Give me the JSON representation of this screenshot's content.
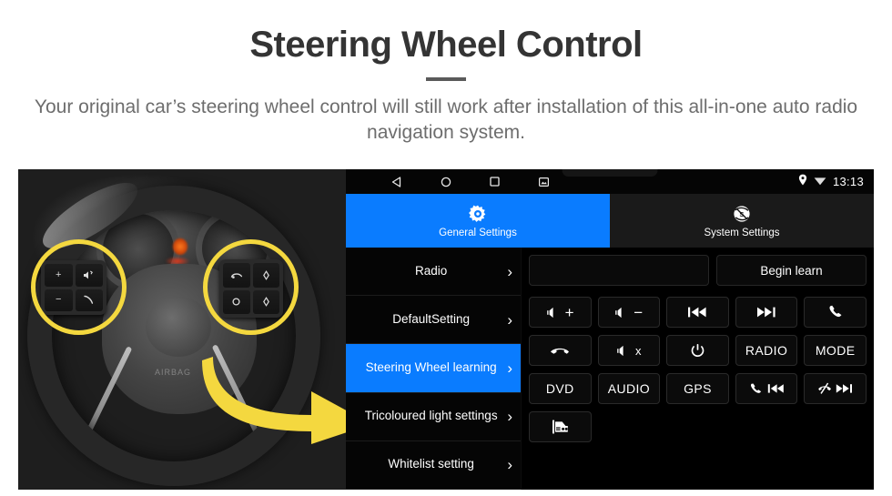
{
  "header": {
    "title": "Steering Wheel Control",
    "subtitle": "Your original car’s steering wheel control will still work after installation of this all-in-one auto radio navigation system."
  },
  "colors": {
    "accent_blue": "#0A7CFF",
    "highlight_yellow": "#F4D83F",
    "screen_background": "#000000",
    "title_text": "#343434",
    "subtitle_text": "#6D6D6D"
  },
  "photo": {
    "alt": "car-steering-wheel-with-control-buttons",
    "hub_logo": "AIRBAG",
    "left_pad_keys": [
      "volume-up-key",
      "voice-command-key",
      "volume-down-key",
      "call-key"
    ],
    "right_pad_keys": [
      "cruise-control-key",
      "diamond-up-key",
      "mode-circle-key",
      "diamond-down-key"
    ],
    "callout_circles": 2,
    "arrow": "yellow-curved-arrow-pointing-right"
  },
  "screen": {
    "status_bar": {
      "nav_buttons": [
        "back-icon",
        "home-icon",
        "recents-icon",
        "screenshot-icon"
      ],
      "indicators": [
        "location-pin-icon",
        "wifi-icon"
      ],
      "time": "13:13"
    },
    "tabs": [
      {
        "label": "General Settings",
        "icon": "gear-icon",
        "active": true
      },
      {
        "label": "System Settings",
        "icon": "system-logo-icon",
        "active": false
      }
    ],
    "sidebar": [
      {
        "label": "Radio",
        "active": false
      },
      {
        "label": "DefaultSetting",
        "active": false
      },
      {
        "label": "Steering Wheel learning",
        "active": true
      },
      {
        "label": "Tricoloured light settings",
        "active": false
      },
      {
        "label": "Whitelist setting",
        "active": false
      }
    ],
    "learn": {
      "input_value": "",
      "input_placeholder": "",
      "button_label": "Begin learn"
    },
    "buttons": [
      {
        "label": "",
        "icon": "volume-up-icon",
        "name": "volume-up-button"
      },
      {
        "label": "",
        "icon": "volume-down-icon",
        "name": "volume-down-button"
      },
      {
        "label": "",
        "icon": "previous-track-icon",
        "name": "previous-track-button"
      },
      {
        "label": "",
        "icon": "next-track-icon",
        "name": "next-track-button"
      },
      {
        "label": "",
        "icon": "call-icon",
        "name": "call-button"
      },
      {
        "label": "",
        "icon": "hang-up-icon",
        "name": "hang-up-button"
      },
      {
        "label": "",
        "icon": "mute-icon",
        "name": "mute-button"
      },
      {
        "label": "",
        "icon": "power-icon",
        "name": "power-button"
      },
      {
        "label": "RADIO",
        "icon": "",
        "name": "radio-button"
      },
      {
        "label": "MODE",
        "icon": "",
        "name": "mode-button"
      },
      {
        "label": "DVD",
        "icon": "",
        "name": "dvd-button"
      },
      {
        "label": "AUDIO",
        "icon": "",
        "name": "audio-button"
      },
      {
        "label": "GPS",
        "icon": "",
        "name": "gps-button"
      },
      {
        "label": "",
        "icon": "call-previous-icon",
        "name": "call-previous-button"
      },
      {
        "label": "",
        "icon": "hangup-next-icon",
        "name": "hangup-next-button"
      },
      {
        "label": "",
        "icon": "car-front-icon",
        "name": "car-settings-button"
      }
    ]
  }
}
